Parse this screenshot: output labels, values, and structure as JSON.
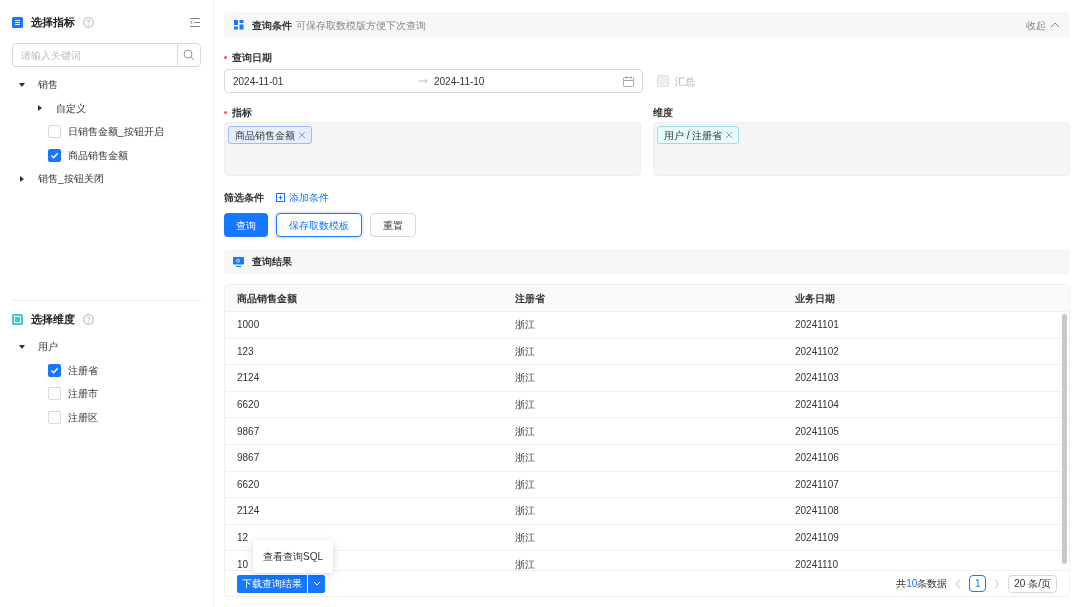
{
  "sidebar": {
    "metrics": {
      "title": "选择指标",
      "search_placeholder": "请输入关键词",
      "tree": [
        {
          "label": "销售",
          "kind": "group",
          "expanded": true,
          "children": [
            {
              "label": "自定义",
              "kind": "group",
              "expanded": false
            },
            {
              "label": "日销售金额_按钮开启",
              "kind": "item",
              "checked": false
            },
            {
              "label": "商品销售金额",
              "kind": "item",
              "checked": true
            }
          ]
        },
        {
          "label": "销售_按钮关闭",
          "kind": "group",
          "expanded": false
        }
      ]
    },
    "dimensions": {
      "title": "选择维度",
      "tree": [
        {
          "label": "用户",
          "kind": "group",
          "expanded": true,
          "children": [
            {
              "label": "注册省",
              "kind": "item",
              "checked": true
            },
            {
              "label": "注册市",
              "kind": "item",
              "checked": false
            },
            {
              "label": "注册区",
              "kind": "item",
              "checked": false
            }
          ]
        }
      ]
    }
  },
  "conditions": {
    "title": "查询条件",
    "hint": "可保存取数模版方便下次查询",
    "collapse_label": "收起",
    "date": {
      "label": "查询日期",
      "required": true,
      "start": "2024-11-01",
      "end": "2024-11-10"
    },
    "summary": {
      "label": "汇总",
      "checked": false
    },
    "metrics": {
      "label": "指标",
      "required": true,
      "tags": [
        "商品销售金额"
      ]
    },
    "dimensions": {
      "label": "维度",
      "required": false,
      "tags": [
        "用户 / 注册省"
      ]
    },
    "filter": {
      "label": "筛选条件",
      "add_label": "添加条件"
    },
    "buttons": [
      {
        "label": "查询",
        "kind": "primary"
      },
      {
        "label": "保存取数模板",
        "kind": "outline"
      },
      {
        "label": "重置",
        "kind": "default"
      }
    ]
  },
  "results": {
    "title": "查询结果",
    "columns": [
      "商品销售金额",
      "注册省",
      "业务日期"
    ],
    "rows": [
      [
        "1000",
        "浙江",
        "20241101"
      ],
      [
        "123",
        "浙江",
        "20241102"
      ],
      [
        "2124",
        "浙江",
        "20241103"
      ],
      [
        "6620",
        "浙江",
        "20241104"
      ],
      [
        "9867",
        "浙江",
        "20241105"
      ],
      [
        "9867",
        "浙江",
        "20241106"
      ],
      [
        "6620",
        "浙江",
        "20241107"
      ],
      [
        "2124",
        "浙江",
        "20241108"
      ],
      [
        "12",
        "浙江",
        "20241109"
      ],
      [
        "10",
        "浙江",
        "20241110"
      ]
    ],
    "menu_item": "查看查询SQL",
    "download_label": "下载查询结果",
    "pagination": {
      "prefix": "共",
      "count": "10",
      "suffix": "条数据",
      "page": "1",
      "page_size": "20 条/页"
    }
  }
}
